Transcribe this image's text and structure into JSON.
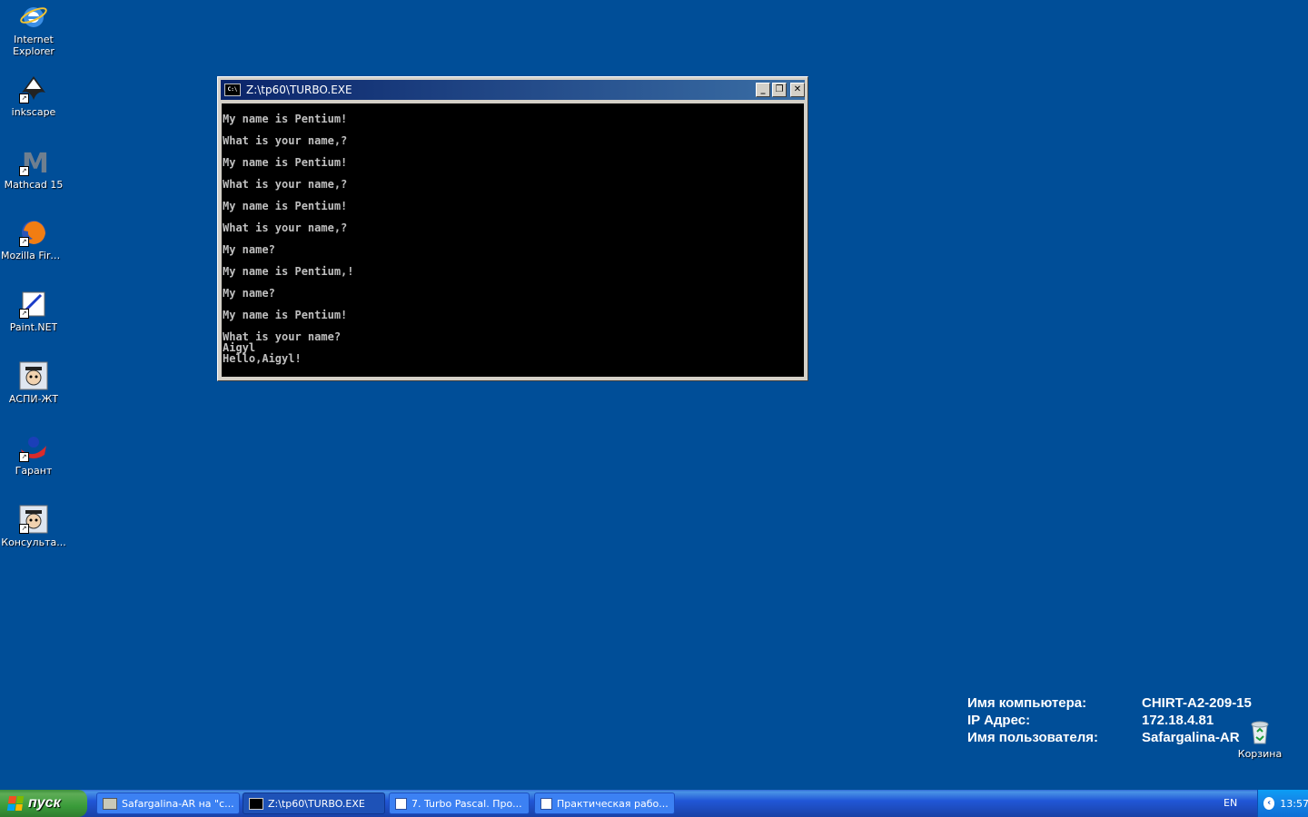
{
  "desktop": {
    "icons": [
      {
        "label": "Internet Explorer",
        "icon": "internet-explorer-icon"
      },
      {
        "label": "inkscape",
        "icon": "inkscape-icon"
      },
      {
        "label": "Mathcad 15",
        "icon": "mathcad-icon"
      },
      {
        "label": "Mozilla Firefox",
        "icon": "firefox-icon"
      },
      {
        "label": "Paint.NET",
        "icon": "paintnet-icon"
      },
      {
        "label": "АСПИ-ЖТ",
        "icon": "aspi-icon"
      },
      {
        "label": "Гарант",
        "icon": "garant-icon"
      },
      {
        "label": "Консульта...",
        "icon": "consultant-icon"
      }
    ],
    "recycle_bin": {
      "label": "Корзина",
      "icon": "recycle-bin-icon"
    }
  },
  "window": {
    "title": "Z:\\tp60\\TURBO.EXE",
    "icon_text": "C:\\",
    "buttons": {
      "minimize": "_",
      "restore": "❐",
      "close": "✕"
    },
    "console_lines": [
      "My name is Pentium!",
      "",
      "What is your name,?",
      "",
      "My name is Pentium!",
      "",
      "What is your name,?",
      "",
      "My name is Pentium!",
      "",
      "What is your name,?",
      "",
      "My name?",
      "",
      "My name is Pentium,!",
      "",
      "My name?",
      "",
      "My name is Pentium!",
      "",
      "What is your name?",
      "Aigyl",
      "Hello,Aigyl!"
    ]
  },
  "info": {
    "rows": [
      {
        "key": "Имя компьютера:",
        "value": "CHIRT-A2-209-15"
      },
      {
        "key": "IP Адрес:",
        "value": "172.18.4.81"
      },
      {
        "key": "Имя пользователя:",
        "value": "Safargalina-AR"
      }
    ]
  },
  "taskbar": {
    "start_label": "пуск",
    "tasks": [
      {
        "label": "Safargalina-AR на \"с...",
        "icon": "network-drive-icon"
      },
      {
        "label": "Z:\\tp60\\TURBO.EXE",
        "icon": "console-icon",
        "active": true
      },
      {
        "label": "7. Turbo Pascal. Про...",
        "icon": "word-document-icon"
      },
      {
        "label": "Практическая рабо...",
        "icon": "word-document-icon"
      }
    ],
    "language": "EN",
    "clock": "13:57"
  }
}
